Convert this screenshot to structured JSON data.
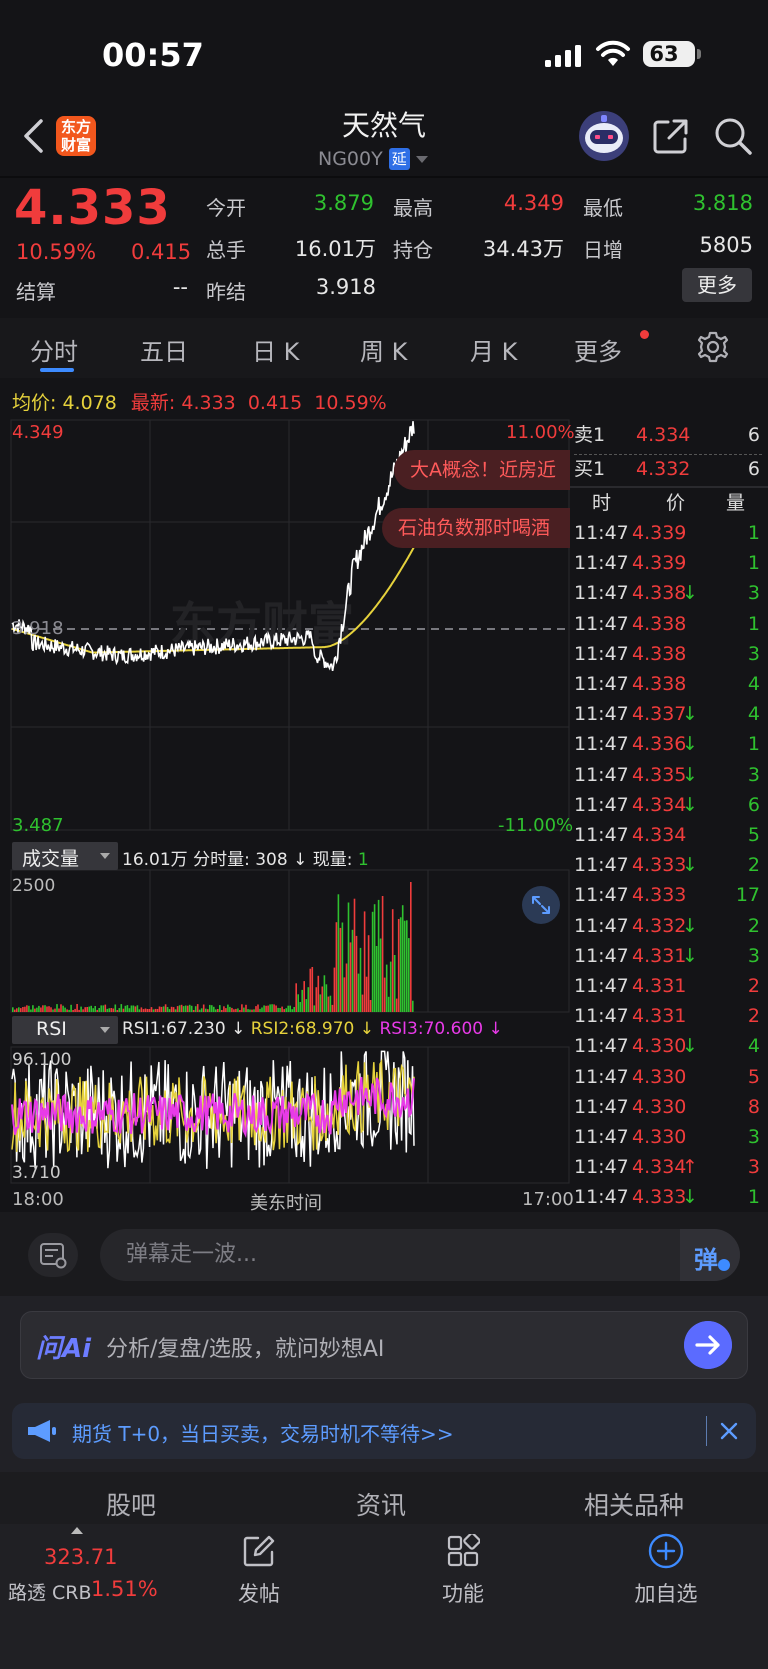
{
  "status_bar": {
    "time": "00:57",
    "battery": "63"
  },
  "header": {
    "logo_text": "东方财富",
    "logo_line1": "东方",
    "logo_line2": "财富",
    "title": "天然气",
    "code": "NG00Y",
    "delay_badge": "延"
  },
  "quote": {
    "price": "4.333",
    "change_pct": "10.59%",
    "change": "0.415",
    "open_label": "今开",
    "open": "3.879",
    "high_label": "最高",
    "high": "4.349",
    "low_label": "最低",
    "low": "3.818",
    "volume_label": "总手",
    "volume": "16.01万",
    "open_interest_label": "持仓",
    "open_interest": "34.43万",
    "daily_increase_label": "日增",
    "daily_increase": "5805",
    "settle_label": "结算",
    "settle": "--",
    "prev_settle_label": "昨结",
    "prev_settle": "3.918",
    "more_button": "更多"
  },
  "tabs": [
    "分时",
    "五日",
    "日 K",
    "周 K",
    "月 K",
    "更多"
  ],
  "active_tab": "分时",
  "avg_line": {
    "avg_label": "均价:",
    "avg_value": "4.078",
    "latest_label": "最新:",
    "latest_value": "4.333",
    "change": "0.415",
    "change_pct": "10.59%"
  },
  "chart": {
    "price_high": "4.349",
    "price_low": "3.487",
    "pct_high": "11.00%",
    "pct_low": "-11.00%",
    "ref_price": "3.918",
    "volume_selector": "成交量",
    "volume_total": "16.01万",
    "time_volume_label": "分时量:",
    "time_volume": "308",
    "current_volume_label": "现量:",
    "current_volume": "1",
    "volume_axis_max": "2500",
    "rsi_selector": "RSI",
    "rsi1_label": "RSI1:",
    "rsi1": "67.230",
    "rsi2_label": "RSI2:",
    "rsi2": "68.970",
    "rsi3_label": "RSI3:",
    "rsi3": "70.600",
    "rsi_axis_max": "96.100",
    "rsi_axis_min": "3.710",
    "time_start": "18:00",
    "time_mid": "美东时间",
    "time_end": "17:00",
    "colors": {
      "up": "#f03c3c",
      "down": "#2fc12f",
      "avg_line": "#e6d23c",
      "rsi3": "#e83ae8"
    }
  },
  "danmaku": [
    "大A概念！近房近",
    "石油负数那时喝酒"
  ],
  "order_book": {
    "sell_label": "卖1",
    "sell_price": "4.334",
    "sell_qty": "6",
    "buy_label": "买1",
    "buy_price": "4.332",
    "buy_qty": "6",
    "headers": [
      "时",
      "价",
      "量"
    ],
    "ticks": [
      {
        "time": "11:47",
        "price": "4.339",
        "arrow": "",
        "qty": "1",
        "qty_color": "green"
      },
      {
        "time": "11:47",
        "price": "4.339",
        "arrow": "",
        "qty": "1",
        "qty_color": "green"
      },
      {
        "time": "11:47",
        "price": "4.338",
        "arrow": "↓",
        "qty": "3",
        "qty_color": "green"
      },
      {
        "time": "11:47",
        "price": "4.338",
        "arrow": "",
        "qty": "1",
        "qty_color": "green"
      },
      {
        "time": "11:47",
        "price": "4.338",
        "arrow": "",
        "qty": "3",
        "qty_color": "green"
      },
      {
        "time": "11:47",
        "price": "4.338",
        "arrow": "",
        "qty": "4",
        "qty_color": "green"
      },
      {
        "time": "11:47",
        "price": "4.337",
        "arrow": "↓",
        "qty": "4",
        "qty_color": "green"
      },
      {
        "time": "11:47",
        "price": "4.336",
        "arrow": "↓",
        "qty": "1",
        "qty_color": "green"
      },
      {
        "time": "11:47",
        "price": "4.335",
        "arrow": "↓",
        "qty": "3",
        "qty_color": "green"
      },
      {
        "time": "11:47",
        "price": "4.334",
        "arrow": "↓",
        "qty": "6",
        "qty_color": "green"
      },
      {
        "time": "11:47",
        "price": "4.334",
        "arrow": "",
        "qty": "5",
        "qty_color": "green"
      },
      {
        "time": "11:47",
        "price": "4.333",
        "arrow": "↓",
        "qty": "2",
        "qty_color": "green"
      },
      {
        "time": "11:47",
        "price": "4.333",
        "arrow": "",
        "qty": "17",
        "qty_color": "green"
      },
      {
        "time": "11:47",
        "price": "4.332",
        "arrow": "↓",
        "qty": "2",
        "qty_color": "green"
      },
      {
        "time": "11:47",
        "price": "4.331",
        "arrow": "↓",
        "qty": "3",
        "qty_color": "green"
      },
      {
        "time": "11:47",
        "price": "4.331",
        "arrow": "",
        "qty": "2",
        "qty_color": "red"
      },
      {
        "time": "11:47",
        "price": "4.331",
        "arrow": "",
        "qty": "2",
        "qty_color": "red"
      },
      {
        "time": "11:47",
        "price": "4.330",
        "arrow": "↓",
        "qty": "4",
        "qty_color": "green"
      },
      {
        "time": "11:47",
        "price": "4.330",
        "arrow": "",
        "qty": "5",
        "qty_color": "red"
      },
      {
        "time": "11:47",
        "price": "4.330",
        "arrow": "",
        "qty": "8",
        "qty_color": "red"
      },
      {
        "time": "11:47",
        "price": "4.330",
        "arrow": "",
        "qty": "3",
        "qty_color": "green"
      },
      {
        "time": "11:47",
        "price": "4.334",
        "arrow": "↑",
        "qty": "3",
        "qty_color": "red"
      },
      {
        "time": "11:47",
        "price": "4.333",
        "arrow": "↓",
        "qty": "1",
        "qty_color": "green"
      }
    ]
  },
  "comment_bar": {
    "placeholder": "弹幕走一波...",
    "toggle_label": "弹"
  },
  "ai_bar": {
    "logo": "问Ai",
    "placeholder": "分析/复盘/选股，就问妙想AI"
  },
  "ad_bar": {
    "text": "期货 T+0，当日买卖，交易时机不等待>>"
  },
  "sub_tabs": [
    "股吧",
    "资讯",
    "相关品种"
  ],
  "bottom_nav": {
    "index_value": "323.71",
    "index_name": "路透 CRB",
    "index_pct": "1.51%",
    "post_label": "发帖",
    "functions_label": "功能",
    "add_watch_label": "加自选"
  }
}
